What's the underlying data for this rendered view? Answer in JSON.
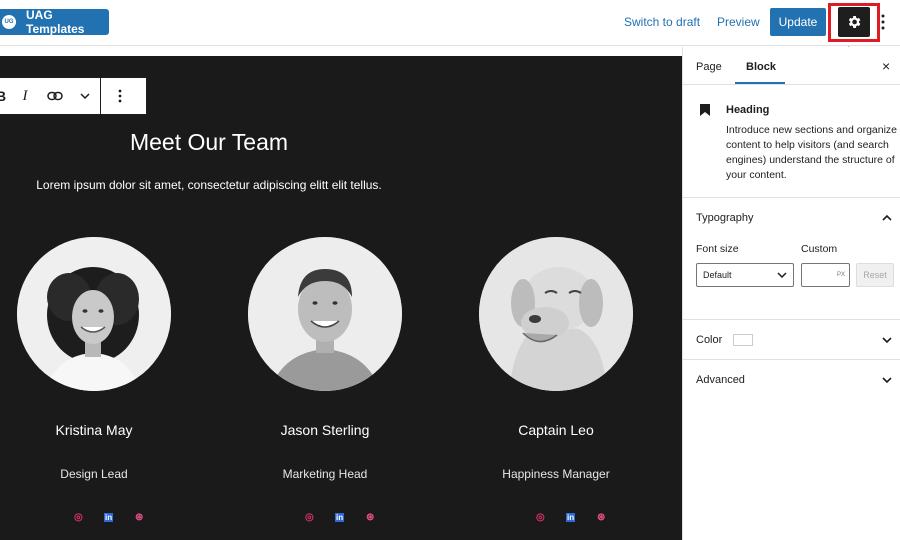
{
  "toolbar": {
    "uag_templates_label": "UAG Templates",
    "uag_logo_text": "UG",
    "switch_to_draft_label": "Switch to draft",
    "preview_label": "Preview",
    "update_label": "Update",
    "settings_icon": "gear-icon",
    "options_icon": "kebab-icon",
    "highlight_color": "#e01b24",
    "accent_color": "#2271b1"
  },
  "canvas": {
    "block_toolbar": {
      "bold_glyph": "B",
      "italic_glyph": "I",
      "icons": [
        "bold-icon",
        "italic-icon",
        "link-icon",
        "chevron-down-icon",
        "more-options-icon"
      ]
    },
    "heading": "Meet Our Team",
    "lede": "Lorem ipsum dolor sit amet, consectetur adipiscing elitt elit tellus.",
    "background_color": "#1a1a1a",
    "members": [
      {
        "name": "Kristina May",
        "role": "Design Lead",
        "photo": "woman-portrait"
      },
      {
        "name": "Jason Sterling",
        "role": "Marketing Head",
        "photo": "man-portrait"
      },
      {
        "name": "Captain Leo",
        "role": "Happiness Manager",
        "photo": "dog-portrait"
      }
    ],
    "social_icons": [
      "instagram-icon",
      "linkedin-icon",
      "dribbble-icon"
    ],
    "social_glyphs": {
      "instagram": "◎",
      "linkedin": "in",
      "dribbble": "⊛"
    },
    "social_colors": {
      "instagram": "#e1306c",
      "linkedin": "#2d6ad6",
      "dribbble": "#ea4c89"
    }
  },
  "sidebar": {
    "tabs": [
      {
        "label": "Page",
        "active": false
      },
      {
        "label": "Block",
        "active": true
      }
    ],
    "close_glyph": "×",
    "block_card": {
      "title": "Heading",
      "description": "Introduce new sections and organize content to help visitors (and search engines) understand the structure of your content."
    },
    "typography": {
      "title": "Typography",
      "font_size_label": "Font size",
      "custom_label": "Custom",
      "font_size_value": "Default",
      "custom_unit": "PX",
      "reset_label": "Reset"
    },
    "color_panel_title": "Color",
    "advanced_panel_title": "Advanced"
  }
}
